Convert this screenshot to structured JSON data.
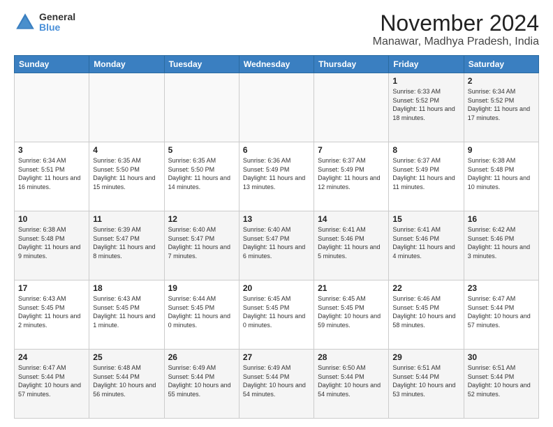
{
  "header": {
    "logo_line1": "General",
    "logo_line2": "Blue",
    "title": "November 2024",
    "subtitle": "Manawar, Madhya Pradesh, India"
  },
  "calendar": {
    "days_of_week": [
      "Sunday",
      "Monday",
      "Tuesday",
      "Wednesday",
      "Thursday",
      "Friday",
      "Saturday"
    ],
    "weeks": [
      [
        {
          "day": "",
          "info": ""
        },
        {
          "day": "",
          "info": ""
        },
        {
          "day": "",
          "info": ""
        },
        {
          "day": "",
          "info": ""
        },
        {
          "day": "",
          "info": ""
        },
        {
          "day": "1",
          "info": "Sunrise: 6:33 AM\nSunset: 5:52 PM\nDaylight: 11 hours and 18 minutes."
        },
        {
          "day": "2",
          "info": "Sunrise: 6:34 AM\nSunset: 5:52 PM\nDaylight: 11 hours and 17 minutes."
        }
      ],
      [
        {
          "day": "3",
          "info": "Sunrise: 6:34 AM\nSunset: 5:51 PM\nDaylight: 11 hours and 16 minutes."
        },
        {
          "day": "4",
          "info": "Sunrise: 6:35 AM\nSunset: 5:50 PM\nDaylight: 11 hours and 15 minutes."
        },
        {
          "day": "5",
          "info": "Sunrise: 6:35 AM\nSunset: 5:50 PM\nDaylight: 11 hours and 14 minutes."
        },
        {
          "day": "6",
          "info": "Sunrise: 6:36 AM\nSunset: 5:49 PM\nDaylight: 11 hours and 13 minutes."
        },
        {
          "day": "7",
          "info": "Sunrise: 6:37 AM\nSunset: 5:49 PM\nDaylight: 11 hours and 12 minutes."
        },
        {
          "day": "8",
          "info": "Sunrise: 6:37 AM\nSunset: 5:49 PM\nDaylight: 11 hours and 11 minutes."
        },
        {
          "day": "9",
          "info": "Sunrise: 6:38 AM\nSunset: 5:48 PM\nDaylight: 11 hours and 10 minutes."
        }
      ],
      [
        {
          "day": "10",
          "info": "Sunrise: 6:38 AM\nSunset: 5:48 PM\nDaylight: 11 hours and 9 minutes."
        },
        {
          "day": "11",
          "info": "Sunrise: 6:39 AM\nSunset: 5:47 PM\nDaylight: 11 hours and 8 minutes."
        },
        {
          "day": "12",
          "info": "Sunrise: 6:40 AM\nSunset: 5:47 PM\nDaylight: 11 hours and 7 minutes."
        },
        {
          "day": "13",
          "info": "Sunrise: 6:40 AM\nSunset: 5:47 PM\nDaylight: 11 hours and 6 minutes."
        },
        {
          "day": "14",
          "info": "Sunrise: 6:41 AM\nSunset: 5:46 PM\nDaylight: 11 hours and 5 minutes."
        },
        {
          "day": "15",
          "info": "Sunrise: 6:41 AM\nSunset: 5:46 PM\nDaylight: 11 hours and 4 minutes."
        },
        {
          "day": "16",
          "info": "Sunrise: 6:42 AM\nSunset: 5:46 PM\nDaylight: 11 hours and 3 minutes."
        }
      ],
      [
        {
          "day": "17",
          "info": "Sunrise: 6:43 AM\nSunset: 5:45 PM\nDaylight: 11 hours and 2 minutes."
        },
        {
          "day": "18",
          "info": "Sunrise: 6:43 AM\nSunset: 5:45 PM\nDaylight: 11 hours and 1 minute."
        },
        {
          "day": "19",
          "info": "Sunrise: 6:44 AM\nSunset: 5:45 PM\nDaylight: 11 hours and 0 minutes."
        },
        {
          "day": "20",
          "info": "Sunrise: 6:45 AM\nSunset: 5:45 PM\nDaylight: 11 hours and 0 minutes."
        },
        {
          "day": "21",
          "info": "Sunrise: 6:45 AM\nSunset: 5:45 PM\nDaylight: 10 hours and 59 minutes."
        },
        {
          "day": "22",
          "info": "Sunrise: 6:46 AM\nSunset: 5:45 PM\nDaylight: 10 hours and 58 minutes."
        },
        {
          "day": "23",
          "info": "Sunrise: 6:47 AM\nSunset: 5:44 PM\nDaylight: 10 hours and 57 minutes."
        }
      ],
      [
        {
          "day": "24",
          "info": "Sunrise: 6:47 AM\nSunset: 5:44 PM\nDaylight: 10 hours and 57 minutes."
        },
        {
          "day": "25",
          "info": "Sunrise: 6:48 AM\nSunset: 5:44 PM\nDaylight: 10 hours and 56 minutes."
        },
        {
          "day": "26",
          "info": "Sunrise: 6:49 AM\nSunset: 5:44 PM\nDaylight: 10 hours and 55 minutes."
        },
        {
          "day": "27",
          "info": "Sunrise: 6:49 AM\nSunset: 5:44 PM\nDaylight: 10 hours and 54 minutes."
        },
        {
          "day": "28",
          "info": "Sunrise: 6:50 AM\nSunset: 5:44 PM\nDaylight: 10 hours and 54 minutes."
        },
        {
          "day": "29",
          "info": "Sunrise: 6:51 AM\nSunset: 5:44 PM\nDaylight: 10 hours and 53 minutes."
        },
        {
          "day": "30",
          "info": "Sunrise: 6:51 AM\nSunset: 5:44 PM\nDaylight: 10 hours and 52 minutes."
        }
      ]
    ]
  }
}
